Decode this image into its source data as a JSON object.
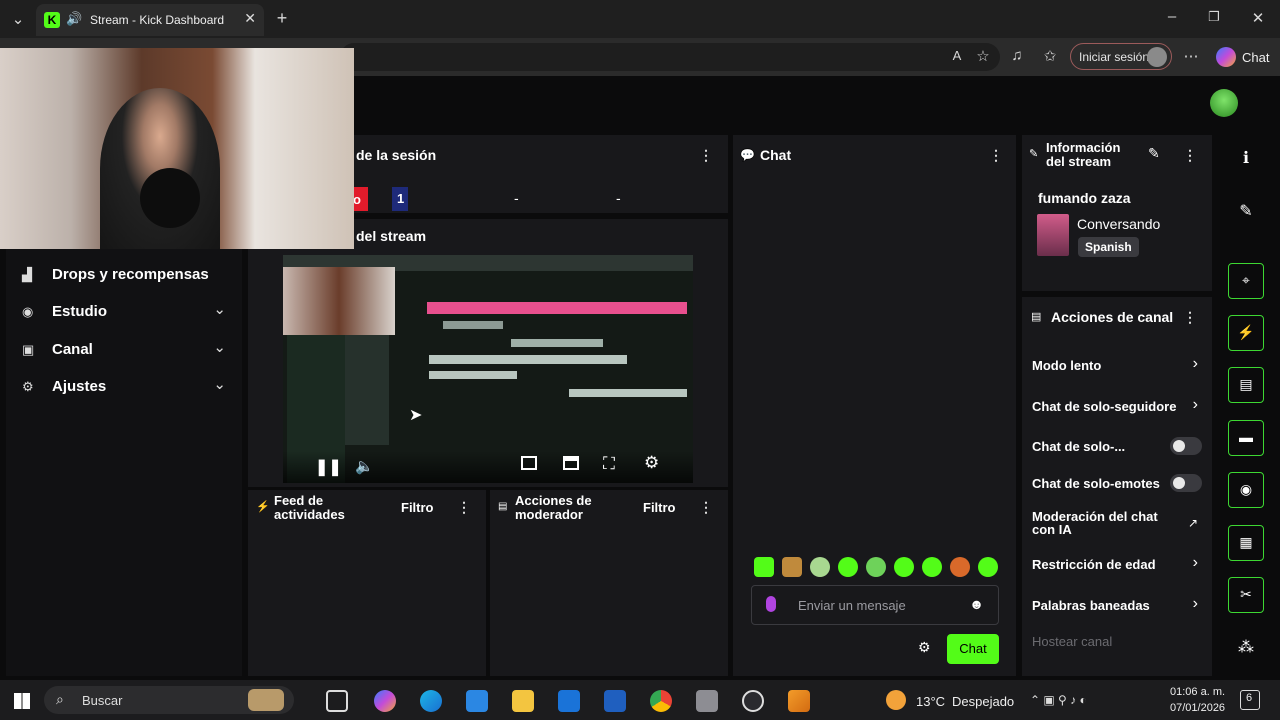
{
  "browser": {
    "tab_title": "Stream - Kick Dashboard",
    "signin_label": "Iniciar sesión",
    "chat_label": "Chat"
  },
  "session_panel": {
    "title": "de la sesión",
    "badge_text": "o",
    "value_1": "1",
    "value_2": "-",
    "value_3": "-"
  },
  "preview_panel": {
    "title": "del stream"
  },
  "sidebar": {
    "items": [
      {
        "label": "Drops y recompensas",
        "icon": "gift-icon"
      },
      {
        "label": "Estudio",
        "icon": "studio-icon"
      },
      {
        "label": "Canal",
        "icon": "channel-icon"
      },
      {
        "label": "Ajustes",
        "icon": "gear-icon"
      }
    ]
  },
  "activity_feed": {
    "title_line1": "Feed de",
    "title_line2": "actividades",
    "filter_label": "Filtro"
  },
  "mod_actions": {
    "title_line1": "Acciones de",
    "title_line2": "moderador",
    "filter_label": "Filtro"
  },
  "chat": {
    "title": "Chat",
    "input_placeholder": "Enviar un mensaje",
    "send_label": "Chat"
  },
  "stream_info": {
    "title_line1": "Información",
    "title_line2": "del stream",
    "stream_title": "fumando zaza",
    "category": "Conversando",
    "language": "Spanish"
  },
  "channel_actions": {
    "title": "Acciones de canal",
    "items": [
      {
        "label": "Modo lento",
        "control": "chevron"
      },
      {
        "label": "Chat de solo-seguidore",
        "control": "chevron"
      },
      {
        "label": "Chat de solo-...",
        "control": "toggle"
      },
      {
        "label": "Chat de solo-emotes",
        "control": "toggle"
      },
      {
        "label": "Moderación del chat con IA",
        "control": "external"
      },
      {
        "label": "Restricción de edad",
        "control": "chevron"
      },
      {
        "label": "Palabras baneadas",
        "control": "chevron"
      },
      {
        "label": "Hostear canal",
        "control": "none"
      }
    ]
  },
  "taskbar": {
    "search_label": "Buscar",
    "weather": "13°C",
    "weather_desc": "Despejado",
    "time": "01:06 a. m.",
    "date": "07/01/2026",
    "notification_count": "6"
  },
  "colors": {
    "accent": "#53fc18",
    "panel": "#18181b",
    "background": "#0b0b0c"
  }
}
